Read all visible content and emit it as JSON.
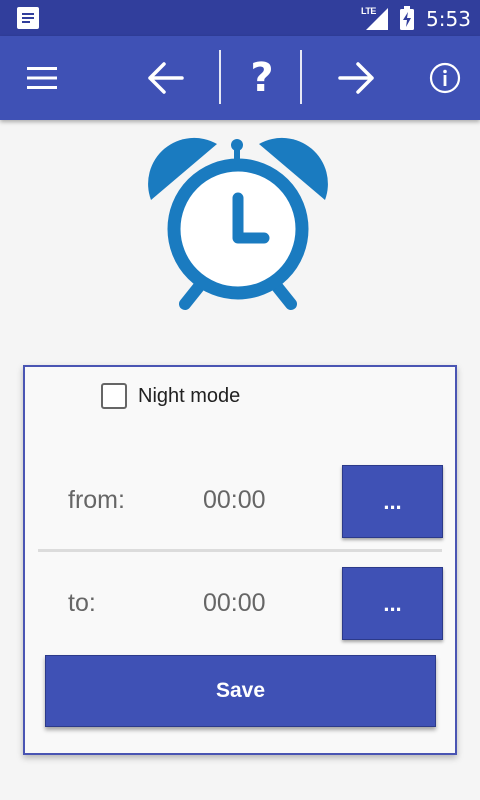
{
  "status_bar": {
    "network": "LTE",
    "time": "5:53",
    "icons": [
      "notification-icon",
      "signal-icon",
      "battery-charging-icon"
    ]
  },
  "toolbar": {
    "menu_icon": "hamburger-menu-icon",
    "back_icon": "arrow-left-icon",
    "help_label": "?",
    "forward_icon": "arrow-right-icon",
    "info_icon": "info-icon"
  },
  "alarm": {
    "icon": "alarm-clock-icon",
    "color": "#1a7bc0"
  },
  "form": {
    "night_mode": {
      "label": "Night mode",
      "checked": false
    },
    "from": {
      "label": "from:",
      "value": "00:00",
      "button_label": "..."
    },
    "to": {
      "label": "to:",
      "value": "00:00",
      "button_label": "..."
    },
    "save_label": "Save"
  },
  "colors": {
    "status_bar": "#313e9c",
    "toolbar": "#3f51b5",
    "accent": "#3f51b5",
    "background": "#f5f5f5"
  }
}
